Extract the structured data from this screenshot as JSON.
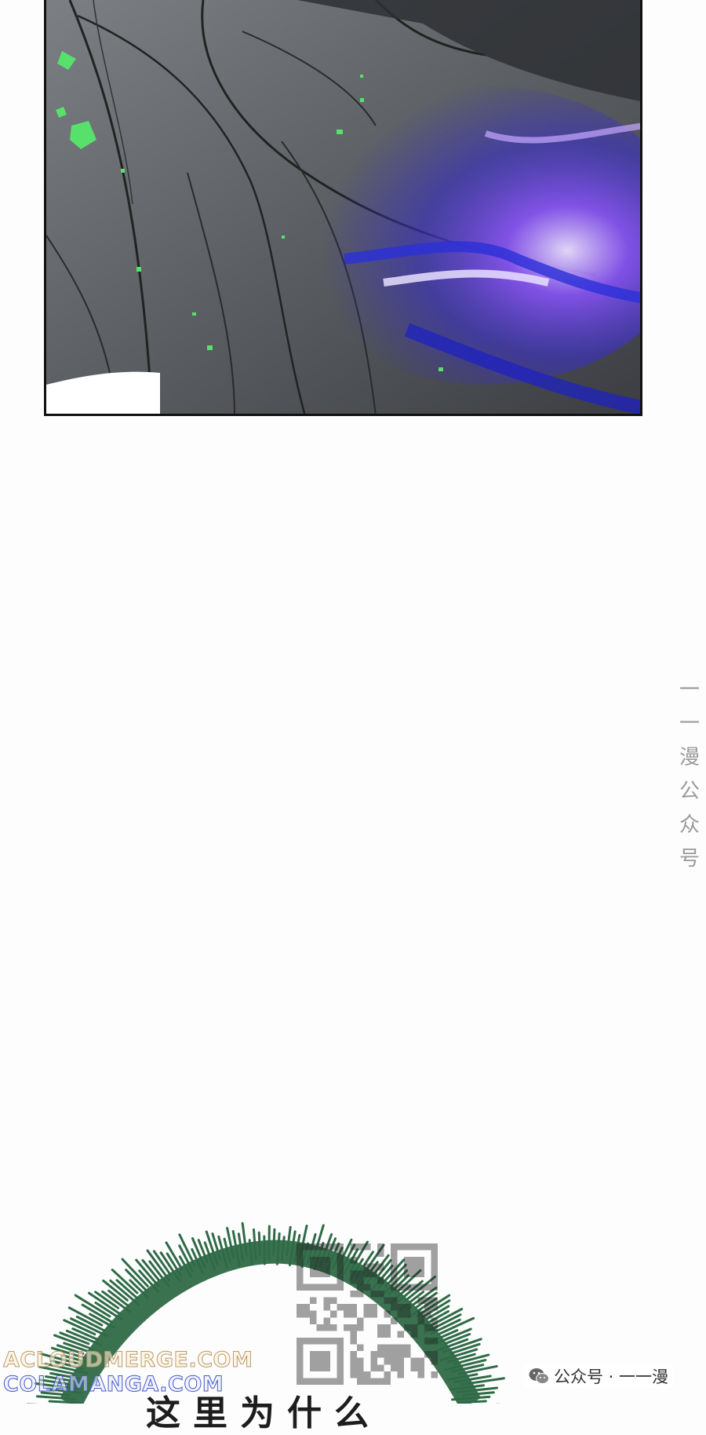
{
  "artwork": {
    "panel_description_icon": "ink-robe-with-purple-energy-slash",
    "colors": {
      "robe_dark": "#3a3c40",
      "robe_mid": "#6b6e73",
      "robe_light": "#8c8f93",
      "energy_purple": "#7a3cf0",
      "energy_glow": "#d9c8ff",
      "energy_blue": "#2a2fd8",
      "sparks_green": "#57e06b",
      "burst_green": "#2f6a47"
    }
  },
  "watermarks": {
    "side_vertical": [
      "一",
      "一",
      "漫",
      "公",
      "众",
      "号"
    ],
    "site_line_1": "ACLOUDMERGE.COM",
    "site_line_2": "COLAMANGA.COM",
    "wechat_label": "公众号 · 一一漫"
  },
  "bottom_caption": "这里为什么"
}
